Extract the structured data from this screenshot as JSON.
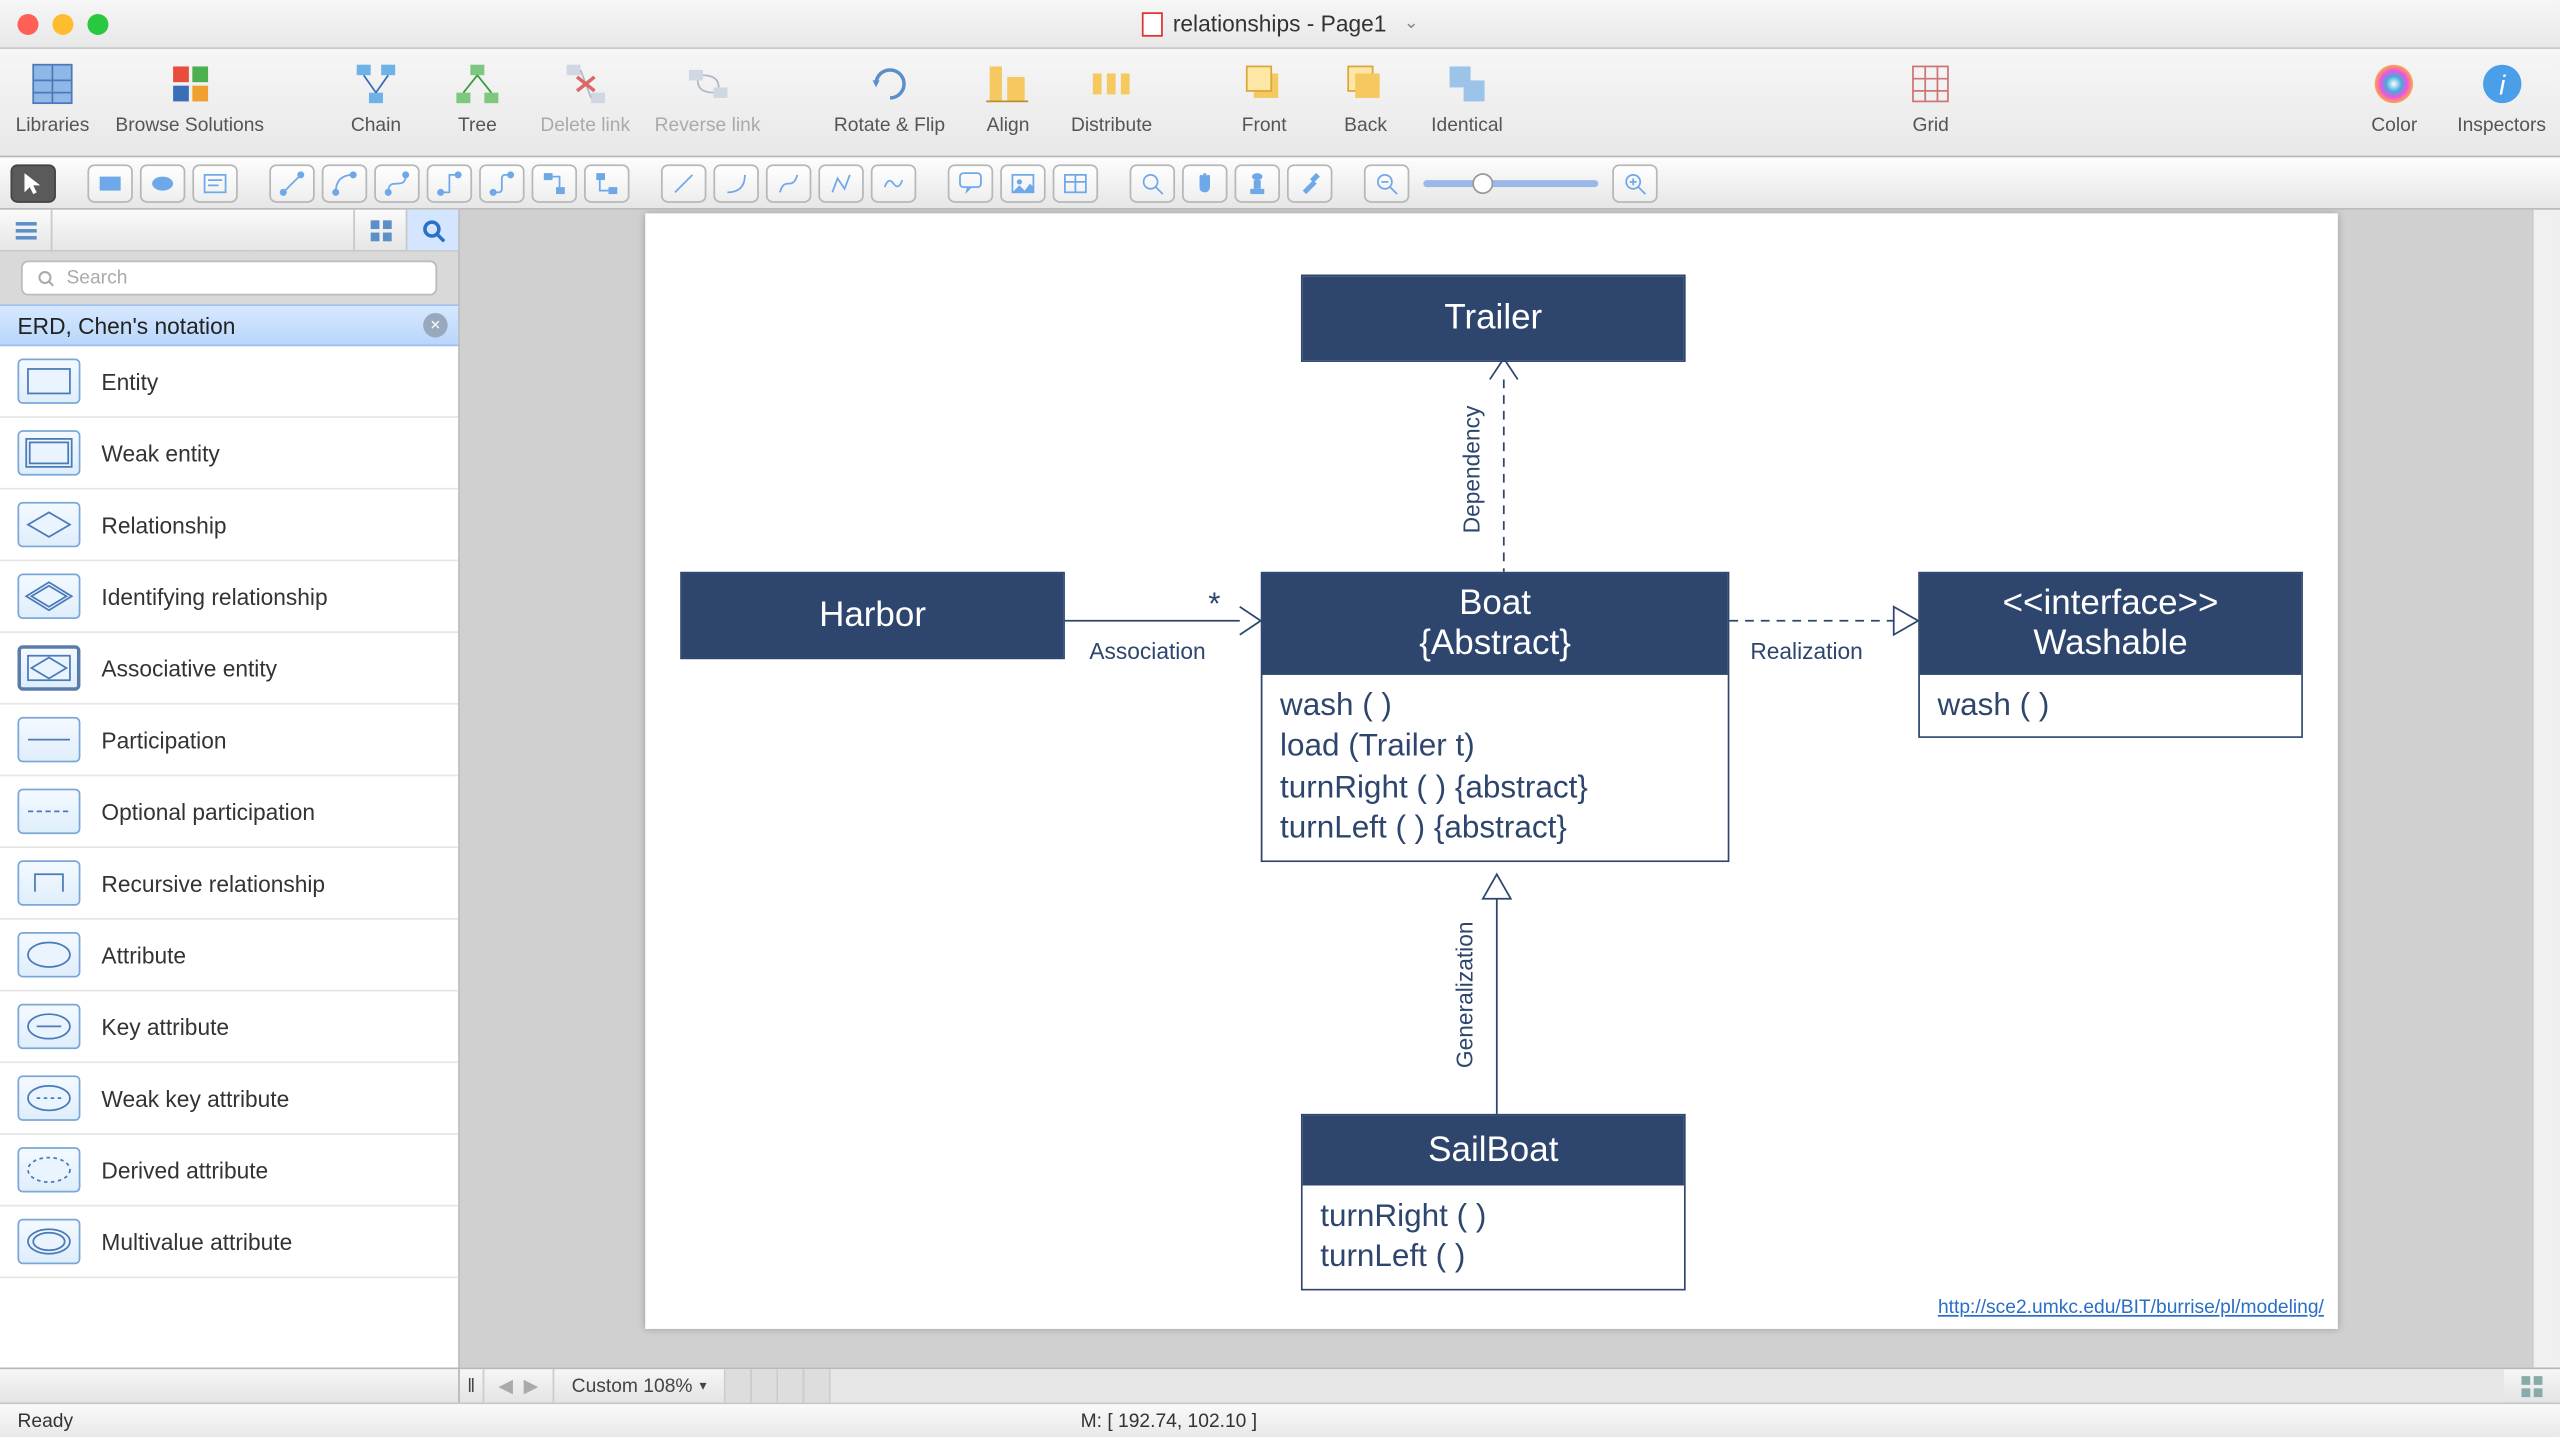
{
  "window": {
    "title": "relationships - Page1"
  },
  "toolbar": {
    "libraries": "Libraries",
    "browse": "Browse Solutions",
    "chain": "Chain",
    "tree": "Tree",
    "delete_link": "Delete link",
    "reverse_link": "Reverse link",
    "rotate_flip": "Rotate & Flip",
    "align": "Align",
    "distribute": "Distribute",
    "front": "Front",
    "back": "Back",
    "identical": "Identical",
    "grid": "Grid",
    "color": "Color",
    "inspectors": "Inspectors"
  },
  "left_panel": {
    "search_placeholder": "Search",
    "category": "ERD, Chen's notation",
    "items": [
      "Entity",
      "Weak entity",
      "Relationship",
      "Identifying relationship",
      "Associative entity",
      "Participation",
      "Optional participation",
      "Recursive relationship",
      "Attribute",
      "Key attribute",
      "Weak key attribute",
      "Derived attribute",
      "Multivalue attribute"
    ]
  },
  "diagram": {
    "trailer": {
      "title": "Trailer"
    },
    "harbor": {
      "title": "Harbor"
    },
    "boat": {
      "title": "Boat",
      "subtitle": "{Abstract}",
      "m1": "wash ( )",
      "m2": "load (Trailer t)",
      "m3": "turnRight ( ) {abstract}",
      "m4": "turnLeft ( ) {abstract}"
    },
    "washable": {
      "stereo": "<<interface>>",
      "title": "Washable",
      "m1": "wash ( )"
    },
    "sailboat": {
      "title": "SailBoat",
      "m1": "turnRight ( )",
      "m2": "turnLeft ( )"
    },
    "labels": {
      "dependency": "Dependency",
      "association": "Association",
      "star": "*",
      "realization": "Realization",
      "generalization": "Generalization"
    },
    "url": "http://sce2.umkc.edu/BIT/burrise/pl/modeling/"
  },
  "bottom": {
    "zoom": "Custom 108%"
  },
  "status": {
    "ready": "Ready",
    "mouse": "M: [ 192.74, 102.10 ]"
  }
}
